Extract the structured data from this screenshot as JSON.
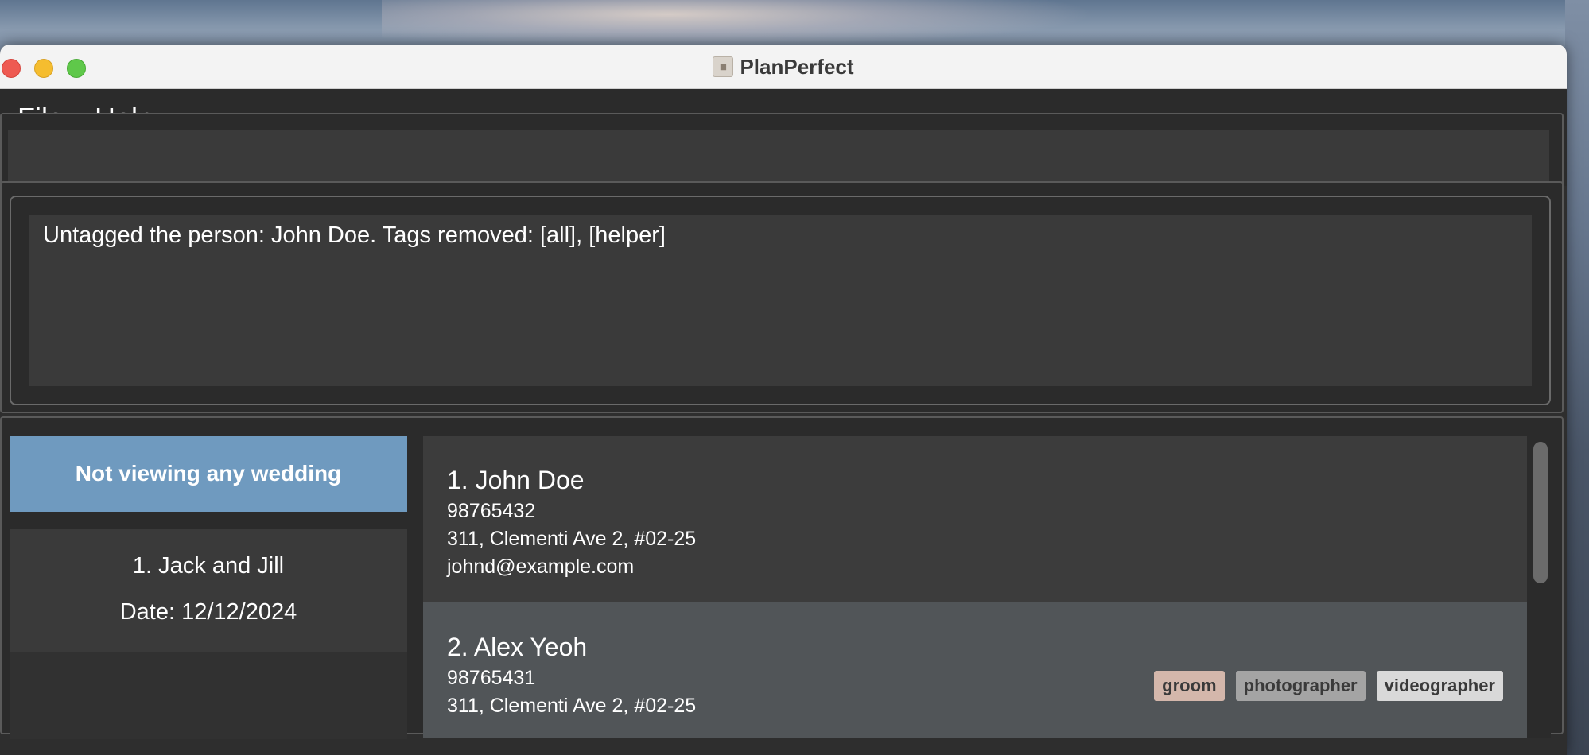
{
  "window": {
    "title": "PlanPerfect"
  },
  "menu": {
    "items": [
      "File",
      "Help"
    ]
  },
  "command": {
    "value": "",
    "placeholder": ""
  },
  "result": {
    "message": "Untagged the person: John Doe. Tags removed: [all], [helper]"
  },
  "wedding_panel": {
    "header": "Not viewing any wedding",
    "weddings": [
      {
        "name": "1. Jack and Jill",
        "date": "Date: 12/12/2024"
      }
    ]
  },
  "persons": [
    {
      "name": "1. John Doe",
      "phone": "98765432",
      "address": "311, Clementi Ave 2, #02-25",
      "email": "johnd@example.com",
      "tags": []
    },
    {
      "name": "2. Alex Yeoh",
      "phone": "98765431",
      "address": "311, Clementi Ave 2, #02-25",
      "tags": [
        "groom",
        "photographer",
        "videographer"
      ]
    }
  ],
  "colors": {
    "wedding_header": "#6f9abf",
    "tag_groom": "#d4b7ab",
    "tag_photographer": "#a4a4a4",
    "tag_videographer": "#d9d9d9",
    "window_bg": "#2e2e2e"
  },
  "icons": {
    "app_icon": "contacts-book-icon"
  }
}
